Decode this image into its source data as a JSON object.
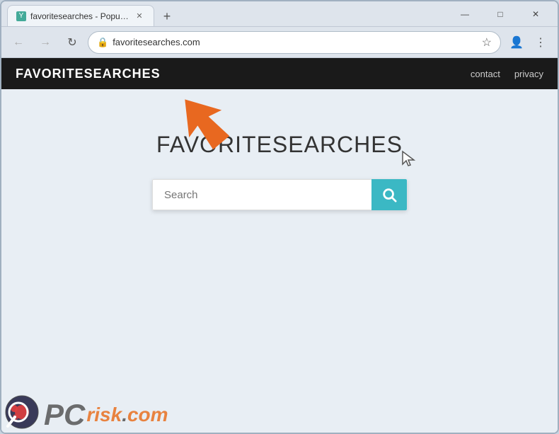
{
  "browser": {
    "tab_title": "favoritesearches - Popular Sear...",
    "tab_favicon": "Y",
    "new_tab_label": "+",
    "url": "favoritesearches.com",
    "back_label": "←",
    "forward_label": "→",
    "refresh_label": "↻",
    "minimize_label": "—",
    "maximize_label": "□",
    "close_label": "✕"
  },
  "site": {
    "logo": "FAVORITESEARCHES",
    "nav": {
      "contact": "contact",
      "privacy": "privacy"
    },
    "title": "FAVORITESEARCHES",
    "search_placeholder": "Search",
    "search_button_icon": "🔍"
  },
  "watermark": {
    "pc": "PC",
    "risk": "risk",
    "dot": ".",
    "com": "com"
  }
}
